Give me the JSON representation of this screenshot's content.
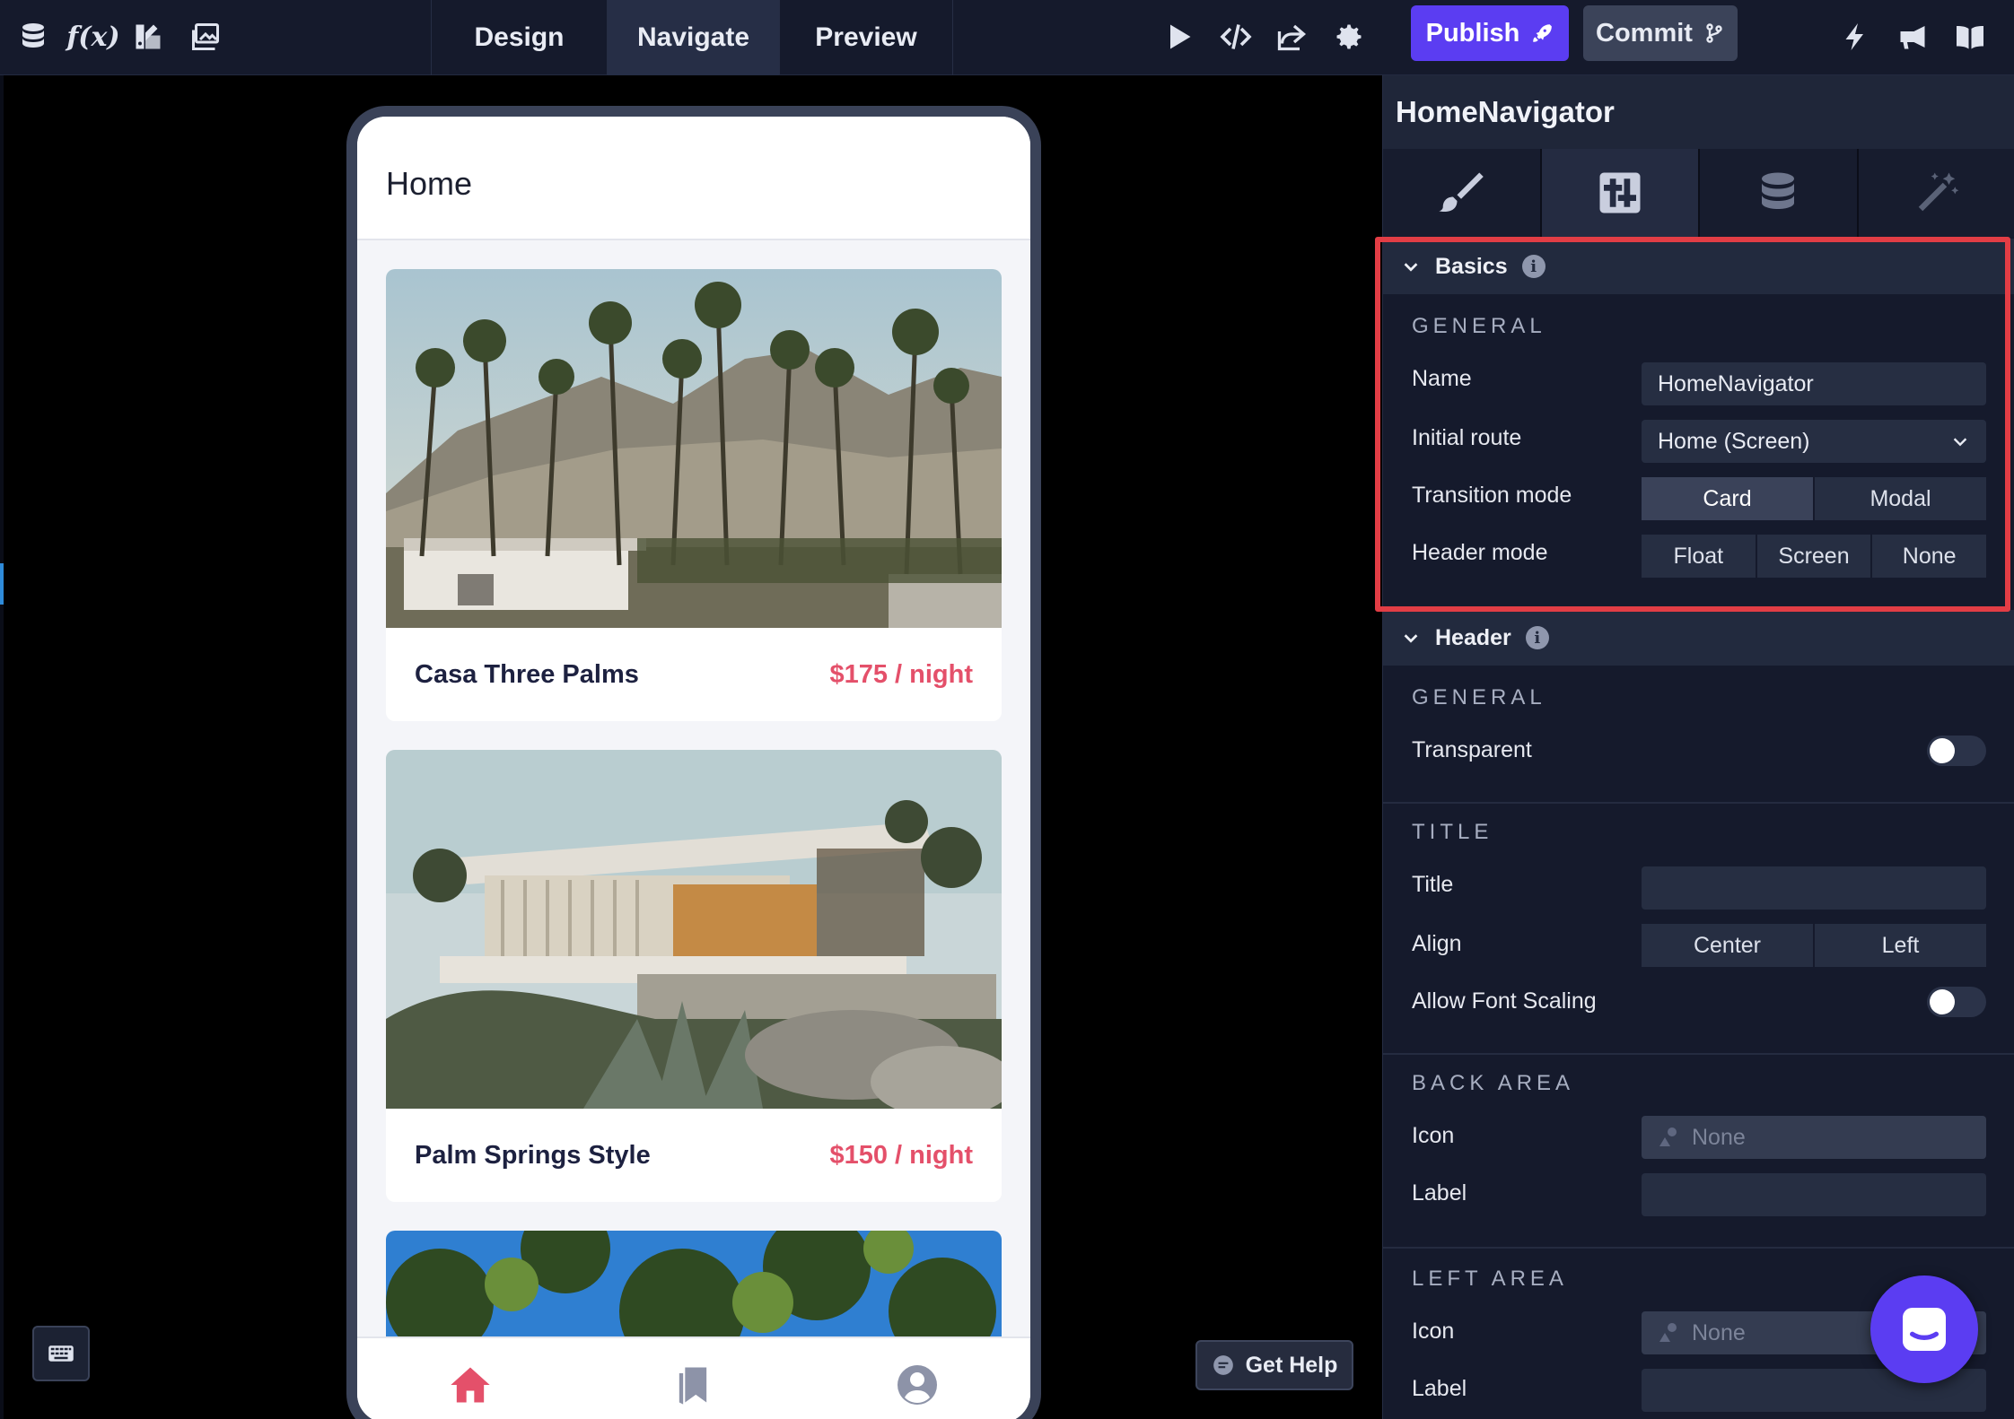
{
  "topbar": {
    "tabs": [
      "Design",
      "Navigate",
      "Preview"
    ],
    "publish_label": "Publish",
    "commit_label": "Commit",
    "icons": [
      "database-icon",
      "function-icon",
      "paint-icon",
      "image-icon",
      "play-icon",
      "code-icon",
      "share-icon",
      "gear-icon",
      "lightning-icon",
      "megaphone-icon",
      "book-icon"
    ]
  },
  "phone": {
    "title": "Home",
    "cards": [
      {
        "name": "Casa Three Palms",
        "price": "$175 / night"
      },
      {
        "name": "Palm Springs Style",
        "price": "$150 / night"
      }
    ]
  },
  "get_help": "Get Help",
  "panel": {
    "title": "HomeNavigator",
    "basics": {
      "heading": "Basics",
      "group": "GENERAL",
      "name_label": "Name",
      "name_value": "HomeNavigator",
      "initial_route_label": "Initial route",
      "initial_route_value": "Home (Screen)",
      "transition_label": "Transition mode",
      "transition_options": [
        "Card",
        "Modal"
      ],
      "header_mode_label": "Header mode",
      "header_mode_options": [
        "Float",
        "Screen",
        "None"
      ]
    },
    "header": {
      "heading": "Header",
      "group_general": "GENERAL",
      "transparent_label": "Transparent",
      "group_title": "TITLE",
      "title_label": "Title",
      "title_value": "",
      "align_label": "Align",
      "align_options": [
        "Center",
        "Left"
      ],
      "font_scaling_label": "Allow Font Scaling",
      "group_back": "BACK AREA",
      "back_icon_label": "Icon",
      "back_icon_value": "None",
      "back_label_label": "Label",
      "group_left": "LEFT AREA",
      "left_icon_label": "Icon",
      "left_icon_value": "None",
      "left_label_label": "Label"
    }
  },
  "colors": {
    "accent": "#5b3df2",
    "price": "#e4506a",
    "highlight": "#e23d45"
  }
}
